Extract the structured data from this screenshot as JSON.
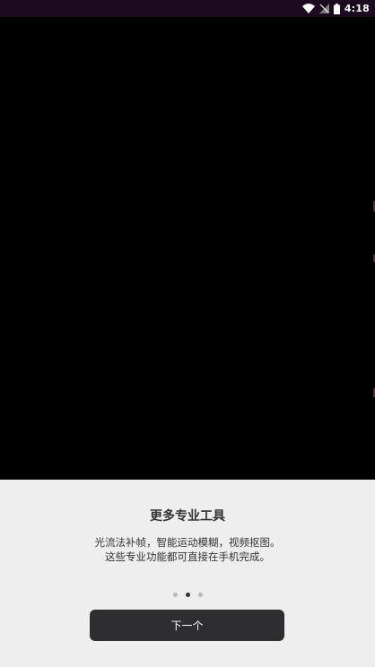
{
  "status_bar": {
    "time": "4:18",
    "icons": [
      "wifi-icon",
      "signal-no-sim-icon",
      "battery-icon"
    ]
  },
  "video": {
    "background": "#000000"
  },
  "onboarding": {
    "title": "更多专业工具",
    "description_line1": "光流法补帧，智能运动模糊，视频抠图。",
    "description_line2": "这些专业功能都可直接在手机完成。",
    "pager": {
      "page_count": 3,
      "current_page": 2
    },
    "next_button_label": "下一个"
  },
  "colors": {
    "status_bar": "#1c0a20",
    "panel_background": "#eeeeee",
    "button_background": "#2e2e30",
    "text_dark": "#333333"
  }
}
